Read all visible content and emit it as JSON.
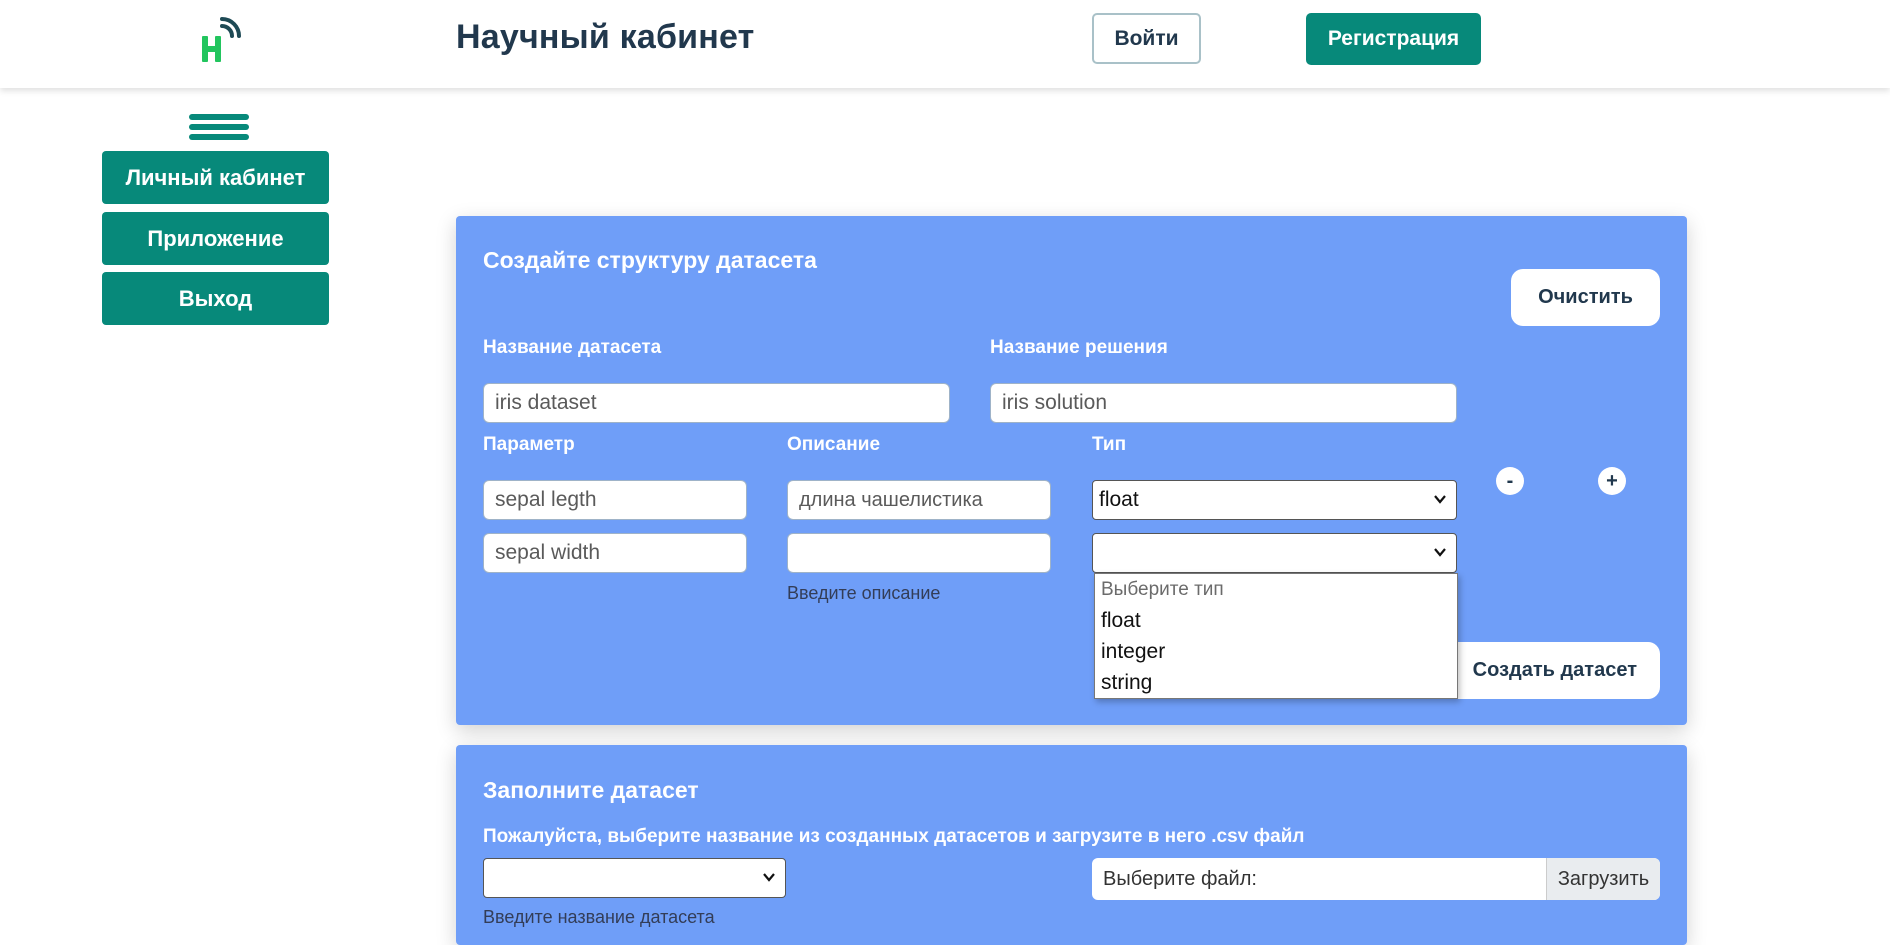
{
  "header": {
    "logo_icon": "signal-h-logo-icon",
    "title": "Научный кабинет",
    "login_label": "Войти",
    "register_label": "Регистрация"
  },
  "sidebar": {
    "menu_icon": "hamburger-icon",
    "items": [
      {
        "label": "Личный кабинет"
      },
      {
        "label": "Приложение"
      },
      {
        "label": "Выход"
      }
    ]
  },
  "create_panel": {
    "heading": "Создайте структуру датасета",
    "clear_label": "Очистить",
    "dataset_name_label": "Название датасета",
    "dataset_name_value": "iris dataset",
    "solution_name_label": "Название решения",
    "solution_name_value": "iris solution",
    "columns": {
      "param": "Параметр",
      "description": "Описание",
      "type": "Тип"
    },
    "rows": [
      {
        "param": "sepal legth",
        "description": "длина чашелистика",
        "type": "float"
      },
      {
        "param": "sepal width",
        "description": "",
        "type": ""
      }
    ],
    "description_hint": "Введите описание",
    "remove_label": "-",
    "add_label": "+",
    "type_dropdown": {
      "placeholder": "Выберите тип",
      "options": [
        "float",
        "integer",
        "string"
      ]
    },
    "create_label": "Создать датасет"
  },
  "fill_panel": {
    "heading": "Заполните датасет",
    "instruction": "Пожалуйста, выберите название из созданных датасетов и загрузите в него .csv файл",
    "dataset_select_value": "",
    "dataset_hint": "Введите название датасета",
    "file_label": "Выберите файл:",
    "upload_label": "Загрузить"
  },
  "colors": {
    "brand_green": "#07897a",
    "panel_blue": "#6f9ef8",
    "title_dark": "#21384d"
  }
}
